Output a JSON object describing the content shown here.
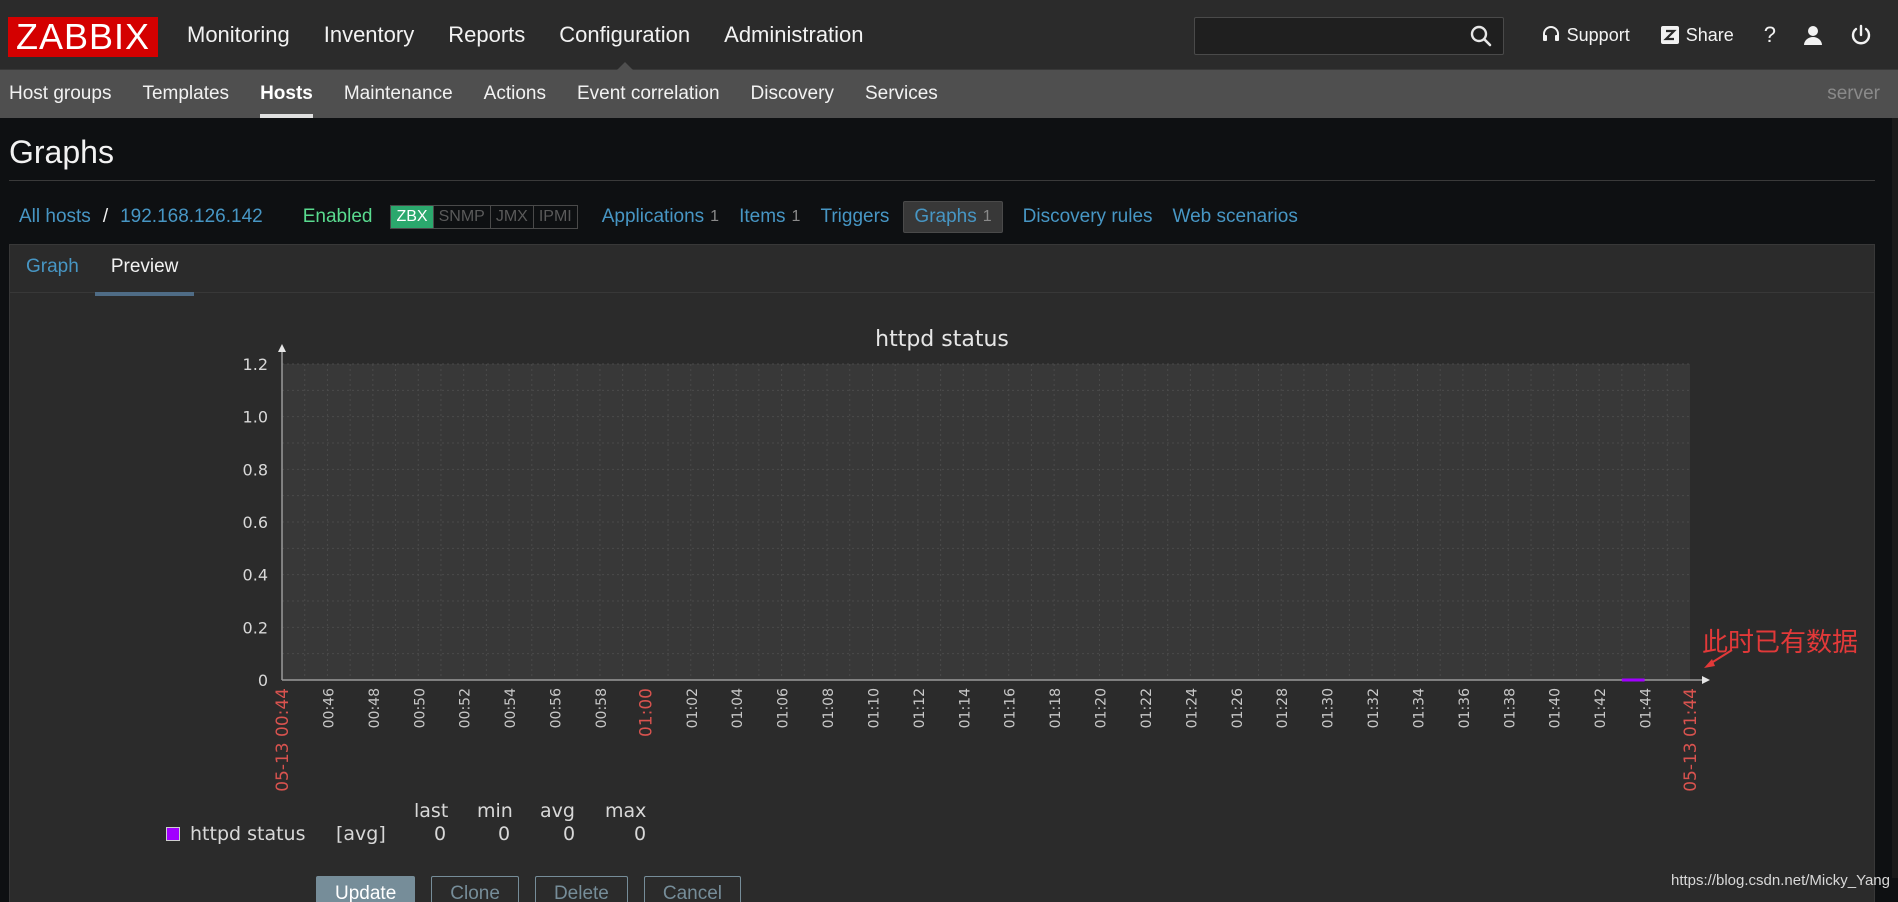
{
  "header": {
    "logo": "ZABBIX",
    "main_nav": [
      "Monitoring",
      "Inventory",
      "Reports",
      "Configuration",
      "Administration"
    ],
    "main_nav_active": "Configuration",
    "support": "Support",
    "share": "Share",
    "help": "?"
  },
  "subnav": {
    "items": [
      "Host groups",
      "Templates",
      "Hosts",
      "Maintenance",
      "Actions",
      "Event correlation",
      "Discovery",
      "Services"
    ],
    "active": "Hosts",
    "server": "server"
  },
  "page": {
    "title": "Graphs"
  },
  "hostnav": {
    "all_hosts": "All hosts",
    "separator": "/",
    "host": "192.168.126.142",
    "status": "Enabled",
    "badges": [
      "ZBX",
      "SNMP",
      "JMX",
      "IPMI"
    ],
    "applications": "Applications",
    "applications_count": "1",
    "items": "Items",
    "items_count": "1",
    "triggers": "Triggers",
    "graphs": "Graphs",
    "graphs_count": "1",
    "discovery_rules": "Discovery rules",
    "web_scenarios": "Web scenarios"
  },
  "tabs": [
    "Graph",
    "Preview"
  ],
  "tabs_active": "Preview",
  "legend": {
    "headers": [
      "last",
      "min",
      "avg",
      "max"
    ],
    "name": "httpd status",
    "func": "[avg]",
    "values": [
      "0",
      "0",
      "0",
      "0"
    ]
  },
  "buttons": {
    "update": "Update",
    "clone": "Clone",
    "delete": "Delete",
    "cancel": "Cancel"
  },
  "annotation": "此时已有数据",
  "watermark": "https://blog.csdn.net/Micky_Yang",
  "colors": {
    "logo": "#d40000",
    "series": "#a100ff",
    "link": "#4796c4",
    "enabled": "#59db8f",
    "annotation": "#e23939"
  },
  "chart_data": {
    "type": "line",
    "title": "httpd status",
    "ylim": [
      0,
      1.2
    ],
    "y_ticks": [
      "0",
      "0.2",
      "0.4",
      "0.6",
      "0.8",
      "1.0",
      "1.2"
    ],
    "x_ticks": [
      "05-13 00:44",
      "00:46",
      "00:48",
      "00:50",
      "00:52",
      "00:54",
      "00:56",
      "00:58",
      "01:00",
      "01:02",
      "01:04",
      "01:06",
      "01:08",
      "01:10",
      "01:12",
      "01:14",
      "01:16",
      "01:18",
      "01:20",
      "01:22",
      "01:24",
      "01:26",
      "01:28",
      "01:30",
      "01:32",
      "01:34",
      "01:36",
      "01:38",
      "01:40",
      "01:42",
      "01:44",
      "05-13 01:44"
    ],
    "highlight_ticks": [
      "05-13 00:44",
      "01:00",
      "05-13 01:44"
    ],
    "grid": true,
    "series": [
      {
        "name": "httpd status",
        "x": [
          "01:43",
          "01:44"
        ],
        "values": [
          0,
          0
        ]
      }
    ]
  }
}
